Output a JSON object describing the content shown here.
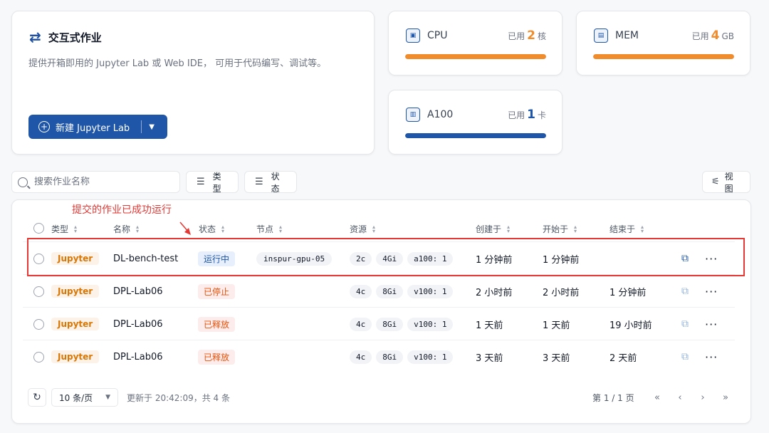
{
  "intro": {
    "title": "交互式作业",
    "description": "提供开箱即用的 Jupyter Lab 或 Web IDE， 可用于代码编写、调试等。",
    "new_button_label": "新建 Jupyter Lab"
  },
  "stats": [
    {
      "name": "CPU",
      "used_prefix": "已用",
      "value": "2",
      "unit": "核",
      "color": "#f08c2b",
      "fill_fraction": 1.0,
      "icon": "cpu-icon"
    },
    {
      "name": "MEM",
      "used_prefix": "已用",
      "value": "4",
      "unit": "GB",
      "color": "#f08c2b",
      "fill_fraction": 1.0,
      "icon": "memory-icon"
    },
    {
      "name": "A100",
      "used_prefix": "已用",
      "value": "1",
      "unit": "卡",
      "color": "#1f56a8",
      "fill_fraction": 1.0,
      "icon": "gpu-icon"
    }
  ],
  "filters": {
    "search_placeholder": "搜索作业名称",
    "type_label": "类型",
    "status_label": "状态",
    "view_label": "视图"
  },
  "annotation": "提交的作业已成功运行",
  "table": {
    "columns": [
      "类型",
      "名称",
      "状态",
      "节点",
      "资源",
      "创建于",
      "开始于",
      "结束于"
    ],
    "rows": [
      {
        "type": "Jupyter",
        "name": "DL-bench-test",
        "status": "运行中",
        "status_kind": "run",
        "node": "inspur-gpu-05",
        "cpu": "2c",
        "mem": "4Gi",
        "gpu": "a100: 1",
        "created": "1 分钟前",
        "started": "1 分钟前",
        "ended": ""
      },
      {
        "type": "Jupyter",
        "name": "DPL-Lab06",
        "status": "已停止",
        "status_kind": "stop",
        "node": "",
        "cpu": "4c",
        "mem": "8Gi",
        "gpu": "v100: 1",
        "created": "2 小时前",
        "started": "2 小时前",
        "ended": "1 分钟前"
      },
      {
        "type": "Jupyter",
        "name": "DPL-Lab06",
        "status": "已释放",
        "status_kind": "stop",
        "node": "",
        "cpu": "4c",
        "mem": "8Gi",
        "gpu": "v100: 1",
        "created": "1 天前",
        "started": "1 天前",
        "ended": "19 小时前"
      },
      {
        "type": "Jupyter",
        "name": "DPL-Lab06",
        "status": "已释放",
        "status_kind": "stop",
        "node": "",
        "cpu": "4c",
        "mem": "8Gi",
        "gpu": "v100: 1",
        "created": "3 天前",
        "started": "3 天前",
        "ended": "2 天前"
      }
    ]
  },
  "pagination": {
    "page_size": "10 条/页",
    "updated": "更新于 20:42:09，共 4 条",
    "page_info": "第 1 / 1 页"
  }
}
